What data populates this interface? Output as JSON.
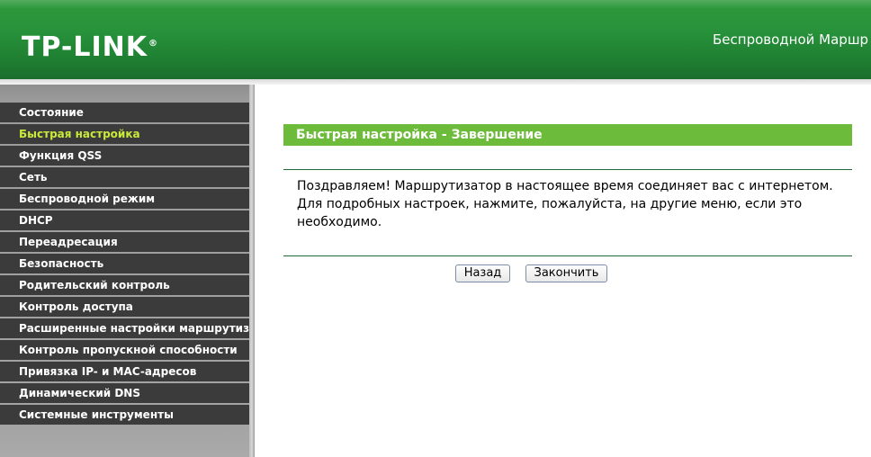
{
  "header": {
    "logo": "TP-LINK",
    "logo_mark": "®",
    "title": "Беспроводной Маршр"
  },
  "sidebar": {
    "items": [
      {
        "label": "Состояние",
        "active": false
      },
      {
        "label": "Быстрая настройка",
        "active": true
      },
      {
        "label": "Функция QSS",
        "active": false
      },
      {
        "label": "Сеть",
        "active": false
      },
      {
        "label": "Беспроводной режим",
        "active": false
      },
      {
        "label": "DHCP",
        "active": false
      },
      {
        "label": "Переадресация",
        "active": false
      },
      {
        "label": "Безопасность",
        "active": false
      },
      {
        "label": "Родительский контроль",
        "active": false
      },
      {
        "label": "Контроль доступа",
        "active": false
      },
      {
        "label": "Расширенные настройки маршрутизации",
        "active": false
      },
      {
        "label": "Контроль пропускной способности",
        "active": false
      },
      {
        "label": "Привязка IP- и MAC-адресов",
        "active": false
      },
      {
        "label": "Динамический DNS",
        "active": false
      },
      {
        "label": "Системные инструменты",
        "active": false
      }
    ]
  },
  "main": {
    "section_title": "Быстрая настройка - Завершение",
    "message": "Поздравляем! Маршрутизатор в настоящее время соединяет вас с интернетом. Для подробных настроек, нажмите, пожалуйста, на другие меню, если это необходимо.",
    "back_label": "Назад",
    "finish_label": "Закончить"
  },
  "colors": {
    "header_green": "#27923a",
    "section_green": "#6dbb3a",
    "menu_bg": "#3b3b3b",
    "menu_active_text": "#c8ea3a",
    "rule_color": "#1e6b3a"
  }
}
